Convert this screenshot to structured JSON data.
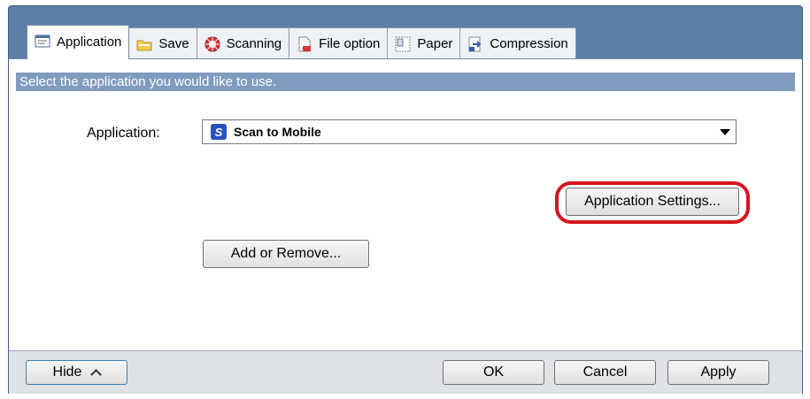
{
  "tabs": [
    {
      "label": "Application",
      "icon": "application-icon",
      "active": true
    },
    {
      "label": "Save",
      "icon": "folder-icon",
      "active": false
    },
    {
      "label": "Scanning",
      "icon": "scanning-icon",
      "active": false
    },
    {
      "label": "File option",
      "icon": "file-option-icon",
      "active": false
    },
    {
      "label": "Paper",
      "icon": "paper-icon",
      "active": false
    },
    {
      "label": "Compression",
      "icon": "compression-icon",
      "active": false
    }
  ],
  "banner": "Select the application you would like to use.",
  "application": {
    "label": "Application:",
    "selected": "Scan to Mobile",
    "icon": "scan-to-mobile-icon"
  },
  "buttons": {
    "app_settings": "Application Settings...",
    "add_remove": "Add or Remove..."
  },
  "footer": {
    "hide": "Hide",
    "ok": "OK",
    "cancel": "Cancel",
    "apply": "Apply"
  },
  "colors": {
    "frame": "#5b7fa6",
    "banner": "#7f9bbf",
    "highlight": "#d8131b"
  }
}
